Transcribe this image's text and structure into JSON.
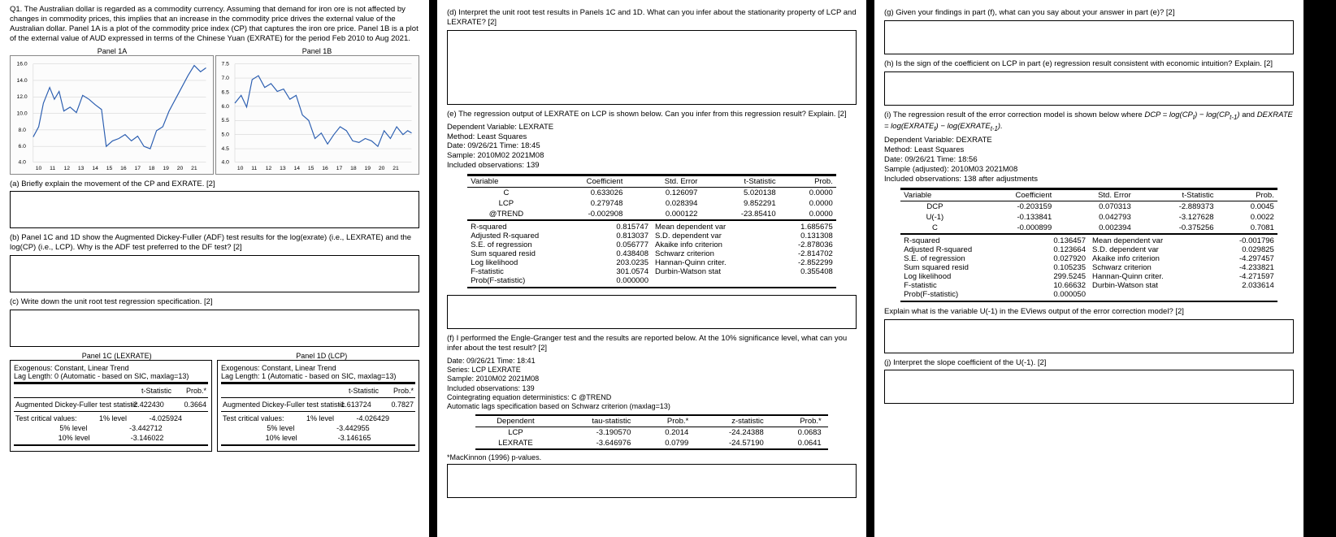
{
  "q1_intro": "Q1. The Australian dollar is regarded as a commodity currency. Assuming that demand for iron ore is not affected by changes in commodity prices, this implies that an increase in the commodity price drives the external value of the Australian dollar. Panel 1A is a plot of the commodity price index (CP) that captures the iron ore price. Panel 1B is a plot of the external value of AUD expressed in terms of the Chinese Yuan (EXRATE) for the period Feb 2010 to Aug 2021.",
  "panel_1a": "Panel 1A",
  "panel_1b": "Panel 1B",
  "prompt_a": "(a) Briefly explain the movement of the CP and EXRATE. [2]",
  "prompt_b": "(b) Panel 1C and 1D show the Augmented Dickey-Fuller (ADF) test results for the log(exrate) (i.e., LEXRATE) and the log(CP) (i.e., LCP). Why is the ADF test preferred to the DF test? [2]",
  "prompt_c": "(c) Write down the unit root test regression specification. [2]",
  "panel_1c": "Panel 1C (LEXRATE)",
  "panel_1d": "Panel 1D (LCP)",
  "adf_exog": "Exogenous: Constant, Linear Trend",
  "adf_c_lag": "Lag Length: 0 (Automatic - based on SIC, maxlag=13)",
  "adf_d_lag": "Lag Length: 1 (Automatic - based on SIC, maxlag=13)",
  "h_tstat": "t-Statistic",
  "h_prob": "Prob.*",
  "adf_stat_lbl": "Augmented Dickey-Fuller test statistic",
  "tcv_lbl": "Test critical values:",
  "lvl1": "1% level",
  "lvl5": "5% level",
  "lvl10": "10% level",
  "adf_c": {
    "tstat": "-2.422430",
    "prob": "0.3664",
    "c1": "-4.025924",
    "c5": "-3.442712",
    "c10": "-3.146022"
  },
  "adf_d": {
    "tstat": "-1.613724",
    "prob": "0.7827",
    "c1": "-4.026429",
    "c5": "-3.442955",
    "c10": "-3.146165"
  },
  "prompt_d": "(d) Interpret the unit root test results in Panels 1C and 1D. What can you infer about the stationarity property of LCP and LEXRATE? [2]",
  "prompt_e": "(e) The regression output of LEXRATE on LCP is shown below. Can you infer from this regression result? Explain. [2]",
  "reg_e_meta": {
    "dv": "Dependent Variable: LEXRATE",
    "method": "Method: Least Squares",
    "date": "Date: 09/26/21  Time: 18:45",
    "sample": "Sample: 2010M02 2021M08",
    "obs": "Included observations: 139"
  },
  "h_var": "Variable",
  "h_coef": "Coefficient",
  "h_se": "Std. Error",
  "h_prob2": "Prob.",
  "reg_e_rows": [
    {
      "v": "C",
      "c": "0.633026",
      "s": "0.126097",
      "t": "5.020138",
      "p": "0.0000"
    },
    {
      "v": "LCP",
      "c": "0.279748",
      "s": "0.028394",
      "t": "9.852291",
      "p": "0.0000"
    },
    {
      "v": "@TREND",
      "c": "-0.002908",
      "s": "0.000122",
      "t": "-23.85410",
      "p": "0.0000"
    }
  ],
  "reg_e_stats": {
    "r2l": "R-squared",
    "r2": "0.815747",
    "mdvl": "Mean dependent var",
    "mdv": "1.685675",
    "ar2l": "Adjusted R-squared",
    "ar2": "0.813037",
    "sdvl": "S.D. dependent var",
    "sdv": "0.131308",
    "sel": "S.E. of regression",
    "se": "0.056777",
    "aicl": "Akaike info criterion",
    "aic": "-2.878036",
    "ssrl": "Sum squared resid",
    "ssr": "0.438408",
    "scl": "Schwarz criterion",
    "sc": "-2.814702",
    "lll": "Log likelihood",
    "ll": "203.0235",
    "hql": "Hannan-Quinn criter.",
    "hq": "-2.852299",
    "fl": "F-statistic",
    "f": "301.0574",
    "dwl": "Durbin-Watson stat",
    "dw": "0.355408",
    "pfl": "Prob(F-statistic)",
    "pf": "0.000000"
  },
  "prompt_f": "(f) I performed the Engle-Granger test and the results are reported below. At the 10% significance level, what can you infer about the test result? [2]",
  "eg_meta": {
    "date": "Date: 09/26/21  Time: 18:41",
    "series": "Series: LCP LEXRATE",
    "sample": "Sample: 2010M02 2021M08",
    "obs": "Included observations: 139",
    "coint": "Cointegrating equation deterministics: C @TREND",
    "lags": "Automatic lags specification based on Schwarz criterion (maxlag=13)"
  },
  "eg_h": {
    "dep": "Dependent",
    "tau": "tau-statistic",
    "prob": "Prob.*",
    "z": "z-statistic",
    "prob2": "Prob.*"
  },
  "eg_rows": [
    {
      "d": "LCP",
      "t": "-3.190570",
      "p": "0.2014",
      "z": "-24.24388",
      "p2": "0.0683"
    },
    {
      "d": "LEXRATE",
      "t": "-3.646976",
      "p": "0.0799",
      "z": "-24.57190",
      "p2": "0.0641"
    }
  ],
  "mk_note": "*MacKinnon (1996) p-values.",
  "prompt_g": "(g) Given your findings in part (f), what can you say about your answer in part (e)? [2]",
  "prompt_h": "(h) Is the sign of the coefficient on LCP in part (e) regression result consistent with economic intuition? Explain. [2]",
  "prompt_i_pre": "(i) The regression result of the error correction model is shown below where ",
  "prompt_i_eq1": "DCP = log(CP",
  "prompt_i_eq1b": ") − log(CP",
  "prompt_i_eq1c": ")",
  "prompt_i_and": " and ",
  "prompt_i_eq2": "DEXRATE = log(EXRATE",
  "prompt_i_eq2b": ") − log(EXRATE",
  "prompt_i_eq2c": ").",
  "reg_i_meta": {
    "dv": "Dependent Variable: DEXRATE",
    "method": "Method: Least Squares",
    "date": "Date: 09/26/21  Time: 18:56",
    "sample": "Sample (adjusted): 2010M03 2021M08",
    "obs": "Included observations: 138 after adjustments"
  },
  "reg_i_rows": [
    {
      "v": "DCP",
      "c": "-0.203159",
      "s": "0.070313",
      "t": "-2.889373",
      "p": "0.0045"
    },
    {
      "v": "U(-1)",
      "c": "-0.133841",
      "s": "0.042793",
      "t": "-3.127628",
      "p": "0.0022"
    },
    {
      "v": "C",
      "c": "-0.000899",
      "s": "0.002394",
      "t": "-0.375256",
      "p": "0.7081"
    }
  ],
  "reg_i_stats": {
    "r2": "0.136457",
    "mdv": "-0.001796",
    "ar2": "0.123664",
    "sdv": "0.029825",
    "se": "0.027920",
    "aic": "-4.297457",
    "ssr": "0.105235",
    "sc": "-4.233821",
    "ll": "299.5245",
    "hq": "-4.271597",
    "f": "10.66632",
    "dw": "2.033614",
    "pf": "0.000050"
  },
  "prompt_i2": "Explain what is the variable U(-1) in the EViews output of the error correction model? [2]",
  "prompt_j": "(j) Interpret the slope coefficient of the U(-1). [2]",
  "chart_data": [
    {
      "type": "line",
      "title": "Panel 1A",
      "xlabel": "",
      "ylabel": "",
      "x": [
        10,
        11,
        12,
        13,
        14,
        15,
        16,
        17,
        18,
        19,
        20,
        21
      ],
      "ylim": [
        4,
        16
      ],
      "series": [
        {
          "name": "CP",
          "values": [
            7,
            13,
            10,
            12,
            11,
            6.5,
            7,
            7.5,
            6,
            8,
            11,
            15
          ]
        }
      ]
    },
    {
      "type": "line",
      "title": "Panel 1B",
      "xlabel": "",
      "ylabel": "",
      "x": [
        10,
        11,
        12,
        13,
        14,
        15,
        16,
        17,
        18,
        19,
        20,
        21
      ],
      "ylim": [
        4,
        7.5
      ],
      "series": [
        {
          "name": "EXRATE",
          "values": [
            6.1,
            6.8,
            6.6,
            6.3,
            5.7,
            4.9,
            4.8,
            5.2,
            4.8,
            4.8,
            4.7,
            5.0
          ]
        }
      ]
    }
  ]
}
